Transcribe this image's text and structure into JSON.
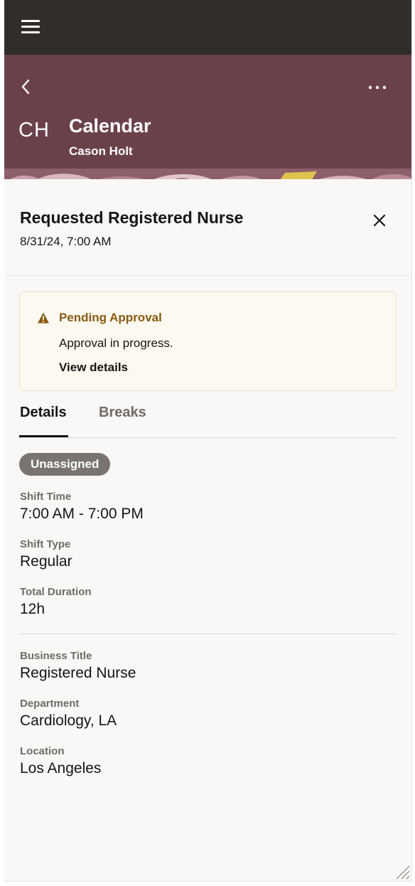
{
  "app": {
    "menu_icon": "hamburger-menu-icon"
  },
  "banner": {
    "back_icon": "chevron-left-icon",
    "more_icon": "more-horizontal-icon",
    "avatar_initials": "CH",
    "title": "Calendar",
    "subtitle": "Cason Holt",
    "background_color": "#6a414b"
  },
  "panel": {
    "title": "Requested Registered Nurse",
    "date": "8/31/24, 7:00 AM",
    "close_icon": "close-icon"
  },
  "notice": {
    "icon": "warning-icon",
    "title": "Pending Approval",
    "message": "Approval in progress.",
    "link": "View details",
    "title_color": "#8a5a12"
  },
  "tabs": [
    {
      "label": "Details",
      "selected": true
    },
    {
      "label": "Breaks",
      "selected": false
    }
  ],
  "status_badge": "Unassigned",
  "shift_fields": [
    {
      "label": "Shift Time",
      "value": "7:00 AM - 7:00 PM"
    },
    {
      "label": "Shift Type",
      "value": "Regular"
    },
    {
      "label": "Total Duration",
      "value": "12h"
    }
  ],
  "job_fields": [
    {
      "label": "Business Title",
      "value": "Registered Nurse"
    },
    {
      "label": "Department",
      "value": "Cardiology, LA"
    },
    {
      "label": "Location",
      "value": "Los Angeles"
    }
  ]
}
